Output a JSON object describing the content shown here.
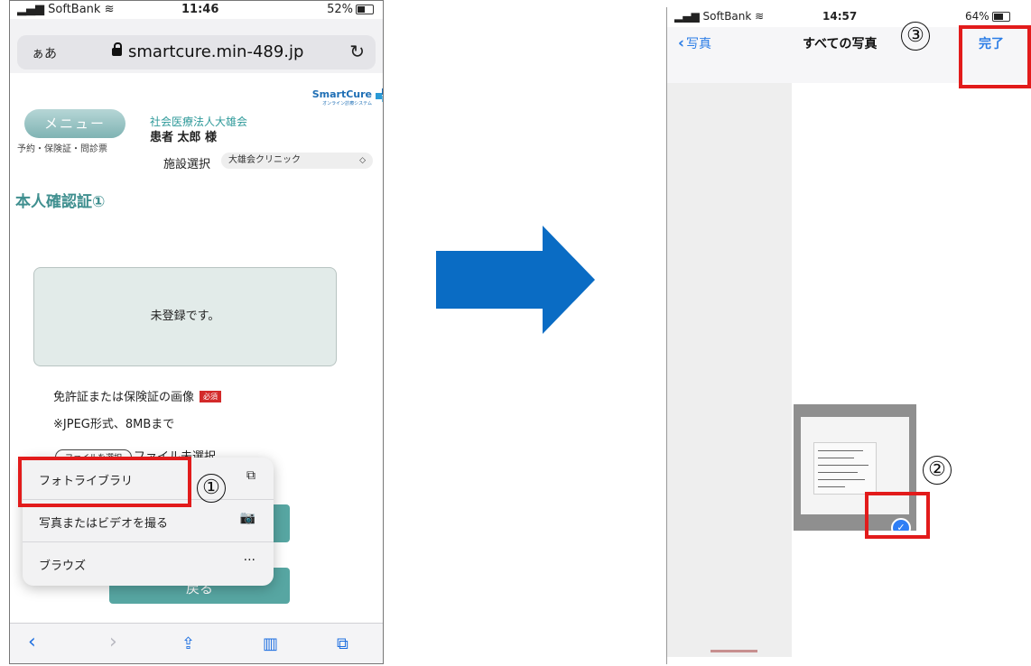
{
  "left": {
    "status": {
      "carrier": "SoftBank",
      "time": "11:46",
      "battery": "52%"
    },
    "urlbar": {
      "aa": "ぁあ",
      "url": "smartcure.min-489.jp"
    },
    "header": {
      "menu": "メニュー",
      "menu_sub": "予約・保険証・問診票",
      "org": "社会医療法人大雄会",
      "patient": "患者 太郎 様",
      "logo": "SmartCure",
      "logo_sub": "オンライン診療システム",
      "facility_label": "施設選択",
      "facility_value": "大雄会クリニック"
    },
    "page_title": "本人確認証①",
    "status_box": "未登録です。",
    "upload_label": "免許証または保険証の画像",
    "required": "必須",
    "format_note": "※JPEG形式、8MBまで",
    "file_button": "ファイルを選択",
    "file_status": "ファイル未選択",
    "back_button": "戻る",
    "popup": [
      {
        "label": "フォトライブラリ",
        "icon": "photo-library-icon"
      },
      {
        "label": "写真またはビデオを撮る",
        "icon": "camera-icon"
      },
      {
        "label": "ブラウズ",
        "icon": "more-icon"
      }
    ]
  },
  "right": {
    "status": {
      "carrier": "SoftBank",
      "time": "14:57",
      "battery": "64%"
    },
    "nav": {
      "back": "写真",
      "title": "すべての写真",
      "done": "完了"
    }
  },
  "annotations": {
    "step1": "①",
    "step2": "②",
    "step3": "③"
  },
  "colors": {
    "accent": "#57a6a2",
    "ios_blue": "#2a7ce6",
    "highlight": "#e21b1b",
    "arrow": "#0a6cc4"
  }
}
